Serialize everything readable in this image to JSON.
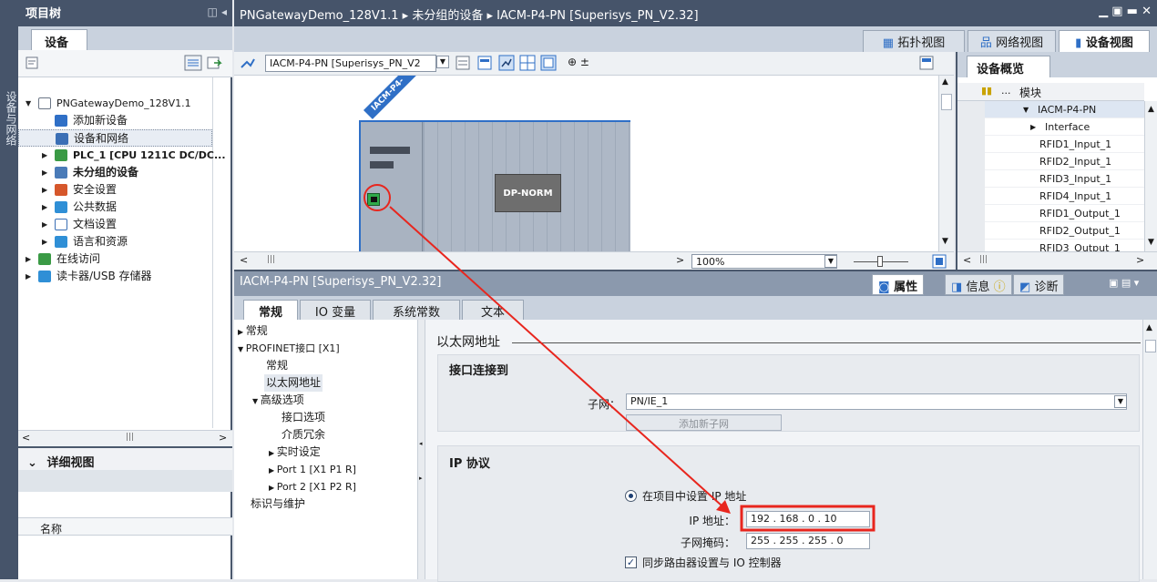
{
  "sidebar_vertical_label": "设备与网络",
  "project_tree": {
    "title": "项目树",
    "tab": "设备",
    "items": [
      {
        "label": "PNGatewayDemo_128V1.1",
        "bold": false
      },
      {
        "label": "添加新设备",
        "bold": false
      },
      {
        "label": "设备和网络",
        "bold": false
      },
      {
        "label": "PLC_1 [CPU 1211C DC/DC...",
        "bold": true
      },
      {
        "label": "未分组的设备",
        "bold": true
      },
      {
        "label": "安全设置",
        "bold": false
      },
      {
        "label": "公共数据",
        "bold": false
      },
      {
        "label": "文档设置",
        "bold": false
      },
      {
        "label": "语言和资源",
        "bold": false
      },
      {
        "label": "在线访问",
        "bold": false
      },
      {
        "label": "读卡器/USB 存储器",
        "bold": false
      }
    ]
  },
  "detail_view": {
    "title": "详细视图",
    "column": "名称"
  },
  "editor": {
    "breadcrumb": [
      "PNGatewayDemo_128V1.1",
      "未分组的设备",
      "IACM-P4-PN [Superisys_PN_V2.32]"
    ],
    "view_tabs": [
      "拓扑视图",
      "网络视图",
      "设备视图"
    ],
    "active_view": "设备视图",
    "device_select": "IACM-P4-PN [Superisys_PN_V2",
    "device_label": "IACM-P4-",
    "module_label": "DP-NORM",
    "zoom": "100%"
  },
  "overview": {
    "tab": "设备概览",
    "column": "模块",
    "rows": [
      "IACM-P4-PN",
      "Interface",
      "RFID1_Input_1",
      "RFID2_Input_1",
      "RFID3_Input_1",
      "RFID4_Input_1",
      "RFID1_Output_1",
      "RFID2_Output_1",
      "RFID3_Output_1"
    ]
  },
  "properties": {
    "title": "IACM-P4-PN [Superisys_PN_V2.32]",
    "right_tabs": [
      "属性",
      "信息",
      "诊断"
    ],
    "sub_tabs": [
      "常规",
      "IO 变量",
      "系统常数",
      "文本"
    ],
    "nav": [
      {
        "label": "常规",
        "indent": 0,
        "arrow": "▶"
      },
      {
        "label": "PROFINET接口 [X1]",
        "indent": 0,
        "arrow": "▼"
      },
      {
        "label": "常规",
        "indent": 1,
        "arrow": ""
      },
      {
        "label": "以太网地址",
        "indent": 1,
        "arrow": ""
      },
      {
        "label": "高级选项",
        "indent": 1,
        "arrow": "▼"
      },
      {
        "label": "接口选项",
        "indent": 2,
        "arrow": ""
      },
      {
        "label": "介质冗余",
        "indent": 2,
        "arrow": ""
      },
      {
        "label": "实时设定",
        "indent": 2,
        "arrow": "▶"
      },
      {
        "label": "Port 1 [X1 P1 R]",
        "indent": 2,
        "arrow": "▶"
      },
      {
        "label": "Port 2 [X1 P2 R]",
        "indent": 2,
        "arrow": "▶"
      },
      {
        "label": "标识与维护",
        "indent": 0,
        "arrow": ""
      }
    ],
    "section_title": "以太网地址",
    "group1_title": "接口连接到",
    "subnet_label": "子网：",
    "subnet_value": "PN/IE_1",
    "add_subnet": "添加新子网",
    "group2_title": "IP 协议",
    "radio_label": "在项目中设置 IP 地址",
    "ip_label": "IP 地址：",
    "ip_value": "192 . 168 . 0    . 10",
    "mask_label": "子网掩码：",
    "mask_value": "255 . 255 . 255 . 0",
    "sync_label": "同步路由器设置与 IO 控制器"
  },
  "colors": {
    "title_bar": "#46546a",
    "highlight": "#e8261e",
    "rack_border": "#2f6fc6"
  }
}
